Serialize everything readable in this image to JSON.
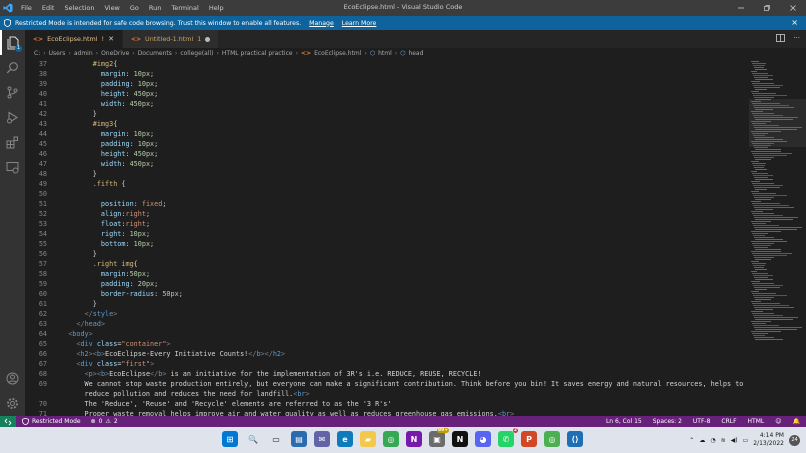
{
  "window": {
    "title": "EcoEclipse.html - Visual Studio Code",
    "menu": [
      "File",
      "Edit",
      "Selection",
      "View",
      "Go",
      "Run",
      "Terminal",
      "Help"
    ],
    "controls": [
      "minimize",
      "restore",
      "close"
    ]
  },
  "banner": {
    "message": "Restricted Mode is intended for safe code browsing. Trust this window to enable all features.",
    "manage": "Manage",
    "learn_more": "Learn More",
    "close": "×"
  },
  "tabs": [
    {
      "label": "EcoEclipse.html",
      "suffix": "!",
      "active": true
    },
    {
      "label": "Untitled-1.html",
      "suffix": "1",
      "active": false
    }
  ],
  "breadcrumb": [
    "C:",
    "Users",
    "admin",
    "OneDrive",
    "Documents",
    "college(all)",
    "HTML practical practice",
    "EcoEclipse.html",
    "html",
    "head"
  ],
  "editor": {
    "lines": [
      {
        "n": "37",
        "t": "        #img2{"
      },
      {
        "n": "38",
        "t": "          margin: 10px;"
      },
      {
        "n": "39",
        "t": "          padding: 10px;"
      },
      {
        "n": "40",
        "t": "          height: 450px;"
      },
      {
        "n": "41",
        "t": "          width: 450px;"
      },
      {
        "n": "42",
        "t": "        }"
      },
      {
        "n": "43",
        "t": "        #img3{"
      },
      {
        "n": "44",
        "t": "          margin: 10px;"
      },
      {
        "n": "45",
        "t": "          padding: 10px;"
      },
      {
        "n": "46",
        "t": "          height: 450px;"
      },
      {
        "n": "47",
        "t": "          width: 450px;"
      },
      {
        "n": "48",
        "t": "        }"
      },
      {
        "n": "49",
        "t": "        .fifth {"
      },
      {
        "n": "50",
        "t": ""
      },
      {
        "n": "51",
        "t": "          position: fixed;"
      },
      {
        "n": "52",
        "t": "          align:right;"
      },
      {
        "n": "53",
        "t": "          float:right;"
      },
      {
        "n": "54",
        "t": "          right: 10px;"
      },
      {
        "n": "55",
        "t": "          bottom: 10px;"
      },
      {
        "n": "56",
        "t": "        }"
      },
      {
        "n": "57",
        "t": "        .right img{"
      },
      {
        "n": "58",
        "t": "          margin:50px;"
      },
      {
        "n": "59",
        "t": "          padding: 20px;"
      },
      {
        "n": "60",
        "t": "          border-radius: 50px;"
      },
      {
        "n": "61",
        "t": "        }"
      },
      {
        "n": "62",
        "t": "      </style>"
      },
      {
        "n": "63",
        "t": "    </head>"
      },
      {
        "n": "64",
        "t": "  <body>"
      },
      {
        "n": "65",
        "t": "    <div class=\"container\">"
      },
      {
        "n": "66",
        "t": "    <h2><b>EcoEclipse-Every Initiative Counts!</b></h2>"
      },
      {
        "n": "67",
        "t": "    <div class=\"first\">"
      },
      {
        "n": "68",
        "t": "      <p><b>EcoEclipse</b> is an initiative for the implementation of 3R's i.e. REDUCE, REUSE, RECYCLE!"
      },
      {
        "n": "69",
        "t": "      We cannot stop waste production entirely, but everyone can make a significant contribution. Think before you bin! It saves energy and natural resources, helps to"
      },
      {
        "n": "",
        "t": "      reduce pollution and reduces the need for landfill.<br>"
      },
      {
        "n": "70",
        "t": "      The 'Reduce', 'Reuse' and 'Recycle' elements are referred to as the '3 R's'"
      },
      {
        "n": "71",
        "t": "      Proper waste removal helps improve air and water quality as well as reduces greenhouse gas emissions.<br>"
      }
    ]
  },
  "status": {
    "restricted": "Restricted Mode",
    "errors": "0",
    "warnings": "2",
    "position": "Ln 6, Col 15",
    "spaces": "Spaces: 2",
    "encoding": "UTF-8",
    "eol": "CRLF",
    "language": "HTML"
  },
  "taskbar": {
    "apps": [
      {
        "name": "start",
        "color": "#0078d4",
        "glyph": "⊞",
        "badge": ""
      },
      {
        "name": "search",
        "color": "#dfe3ec",
        "glyph": "🔍",
        "badge": ""
      },
      {
        "name": "task-view",
        "color": "#dfe3ec",
        "glyph": "▭",
        "badge": ""
      },
      {
        "name": "widgets",
        "color": "#2b6cb0",
        "glyph": "▤",
        "badge": ""
      },
      {
        "name": "teams-chat",
        "color": "#6264a7",
        "glyph": "✉",
        "badge": ""
      },
      {
        "name": "edge",
        "color": "#0f7bbd",
        "glyph": "e",
        "badge": ""
      },
      {
        "name": "file-explorer",
        "color": "#f2c94c",
        "glyph": "▰",
        "badge": ""
      },
      {
        "name": "chrome",
        "color": "#34a853",
        "glyph": "◎",
        "badge": ""
      },
      {
        "name": "onenote",
        "color": "#7719aa",
        "glyph": "N",
        "badge": ""
      },
      {
        "name": "whatsapp-badge-app",
        "color": "#6b6b6b",
        "glyph": "▣",
        "badge": "99+"
      },
      {
        "name": "netflix",
        "color": "#111111",
        "glyph": "N",
        "badge": ""
      },
      {
        "name": "discord",
        "color": "#5865f2",
        "glyph": "◕",
        "badge": ""
      },
      {
        "name": "whatsapp",
        "color": "#25d366",
        "glyph": "✆",
        "badge": "2"
      },
      {
        "name": "powerpoint",
        "color": "#d24726",
        "glyph": "P",
        "badge": ""
      },
      {
        "name": "chrome-profile",
        "color": "#4caf50",
        "glyph": "◎",
        "badge": ""
      },
      {
        "name": "vscode",
        "color": "#1f6fb5",
        "glyph": "⟨⟩",
        "badge": ""
      }
    ],
    "time": "4:14 PM",
    "date": "2/13/2022",
    "notifications": "24"
  }
}
